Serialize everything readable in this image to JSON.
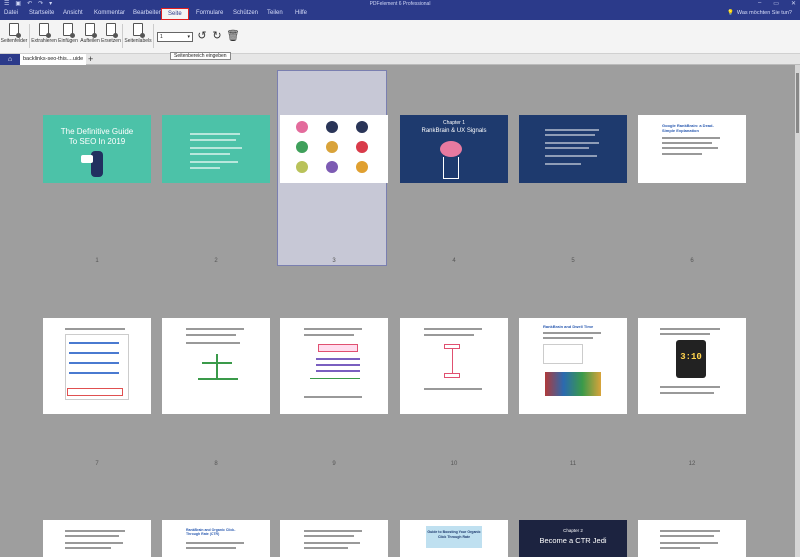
{
  "window": {
    "title": "PDFelement 6 Professional"
  },
  "menu": {
    "tabs": [
      "Datei",
      "Startseite",
      "Ansicht",
      "Kommentar",
      "Bearbeiten",
      "Seite",
      "Formulare",
      "Schützen",
      "Teilen",
      "Hilfe"
    ],
    "active_tab": "Seite",
    "search_label": "Was möchten Sie tun?"
  },
  "ribbon": {
    "buttons": [
      "Seitenfelder",
      "Extrahieren",
      "Einfügen",
      "Aufteilen",
      "Ersetzen",
      "Seitenlabels"
    ],
    "page_range_value": "1",
    "tooltip": "Seitenbereich eingeben"
  },
  "tabs": {
    "document_tab": "backlinks-seo-this....uide"
  },
  "pages": {
    "selected": "3",
    "numbers": [
      "1",
      "2",
      "3",
      "4",
      "5",
      "6",
      "7",
      "8",
      "9",
      "10",
      "11",
      "12"
    ],
    "cover_title": "The Definitive Guide To SEO In 2019",
    "chapter1_label": "Chapter 1",
    "chapter1_title": "RankBrain & UX Signals",
    "page6_heading": "Google RankBrain: a Dead-Simple Explanation",
    "page11_heading": "RankBrain and Dwell Time",
    "phone_time": "3:10",
    "chapter2_label": "Chapter 2",
    "chapter2_title": "Become a CTR Jedi",
    "row3_p2_heading": "RankBrain and Organic Click-Through Rate (CTR)",
    "row3_p4_heading": "Guide to Boosting Your Organic Click Through Rate"
  }
}
